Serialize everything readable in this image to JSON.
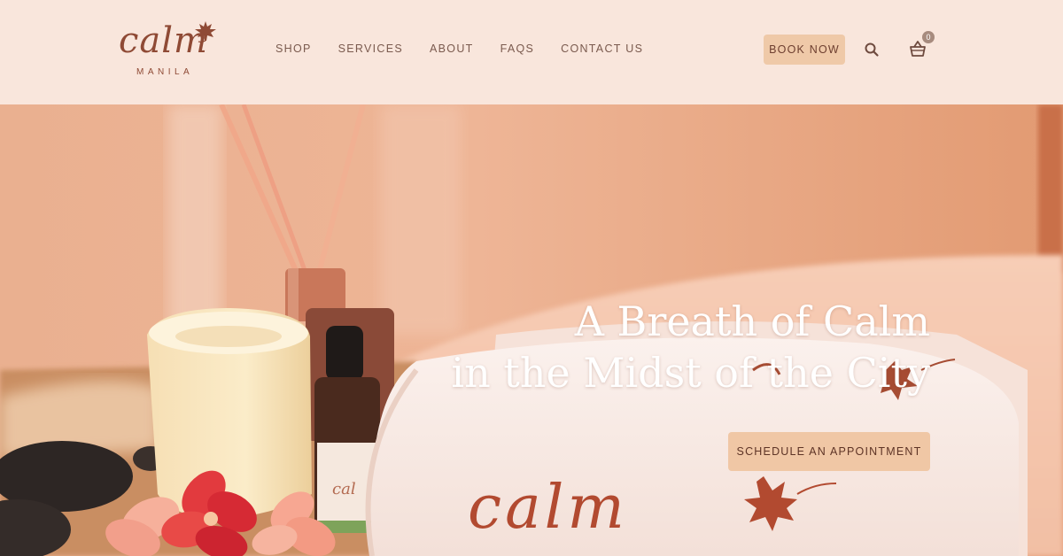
{
  "brand": {
    "logo_word": "calm",
    "logo_sub": "MANILA"
  },
  "nav": {
    "items": [
      {
        "label": "SHOP"
      },
      {
        "label": "SERVICES"
      },
      {
        "label": "ABOUT"
      },
      {
        "label": "FAQS"
      },
      {
        "label": "CONTACT US"
      }
    ]
  },
  "header_actions": {
    "book_label": "BOOK NOW",
    "cart_count": "0",
    "search_icon": "search-icon",
    "cart_icon": "basket-icon"
  },
  "hero": {
    "title_line1": "A Breath of Calm",
    "title_line2": "in the Midst of the City",
    "cta_label": "SCHEDULE AN APPOINTMENT",
    "towel_embroidery": "calm"
  },
  "colors": {
    "header_bg": "#f9e6dc",
    "brand_brown": "#8f4a35",
    "button_bg": "#efc9a8",
    "hero_bg": "#e9a782"
  }
}
